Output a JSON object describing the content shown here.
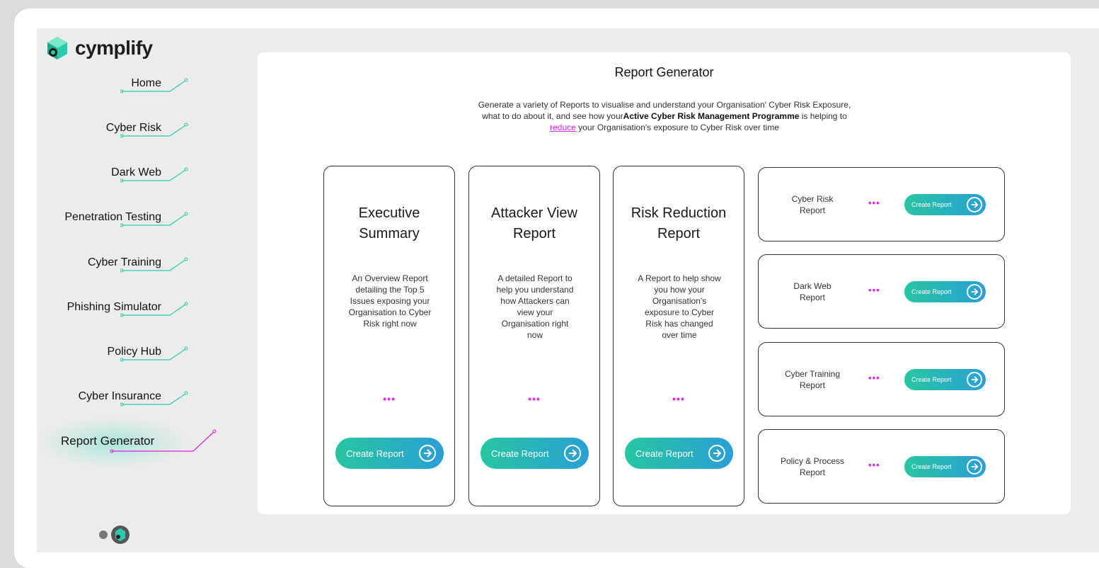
{
  "app": {
    "brand": "cymplify"
  },
  "sidebar": {
    "items": [
      {
        "label": "Home",
        "active": false
      },
      {
        "label": "Cyber Risk",
        "active": false
      },
      {
        "label": "Dark Web",
        "active": false
      },
      {
        "label": "Penetration Testing",
        "active": false
      },
      {
        "label": "Cyber Training",
        "active": false
      },
      {
        "label": "Phishing Simulator",
        "active": false
      },
      {
        "label": "Policy Hub",
        "active": false
      },
      {
        "label": "Cyber Insurance",
        "active": false
      },
      {
        "label": "Report Generator",
        "active": true
      }
    ],
    "line_color": "#2bc9b0",
    "active_line_color": "#e020e0"
  },
  "main": {
    "title": "Report Generator",
    "description": {
      "part1": "Generate a variety of Reports to visualise and understand your Organisation' Cyber Risk Exposure, what to do about it, and see how your",
      "bold": "Active Cyber Risk Management Programme",
      "part2": " is helping to ",
      "link": "reduce",
      "part3": " your Organisation's exposure to Cyber Risk over time"
    },
    "big_cards": [
      {
        "title_line1": "Executive",
        "title_line2": "Summary",
        "description": "An Overview Report detailing the Top 5 Issues exposing your Organisation to Cyber Risk right now",
        "dots": "•••",
        "button": "Create Report"
      },
      {
        "title_line1": "Attacker View",
        "title_line2": "Report",
        "description": "A detailed Report to help you understand how Attackers can view your Organisation right now",
        "dots": "•••",
        "button": "Create Report"
      },
      {
        "title_line1": "Risk Reduction",
        "title_line2": "Report",
        "description": "A Report to help show you how your Organisation's exposure to Cyber Risk has changed over time",
        "dots": "•••",
        "button": "Create Report"
      }
    ],
    "small_cards": [
      {
        "label_line1": "Cyber Risk",
        "label_line2": "Report",
        "dots": "•••",
        "button": "Create Report"
      },
      {
        "label_line1": "Dark Web",
        "label_line2": "Report",
        "dots": "•••",
        "button": "Create Report"
      },
      {
        "label_line1": "Cyber Training",
        "label_line2": "Report",
        "dots": "•••",
        "button": "Create Report"
      },
      {
        "label_line1": "Policy & Process",
        "label_line2": "Report",
        "dots": "•••",
        "button": "Create Report"
      }
    ]
  },
  "colors": {
    "accent_start": "#27c6a0",
    "accent_end": "#2a9fd6",
    "dots": "#e020e0"
  }
}
